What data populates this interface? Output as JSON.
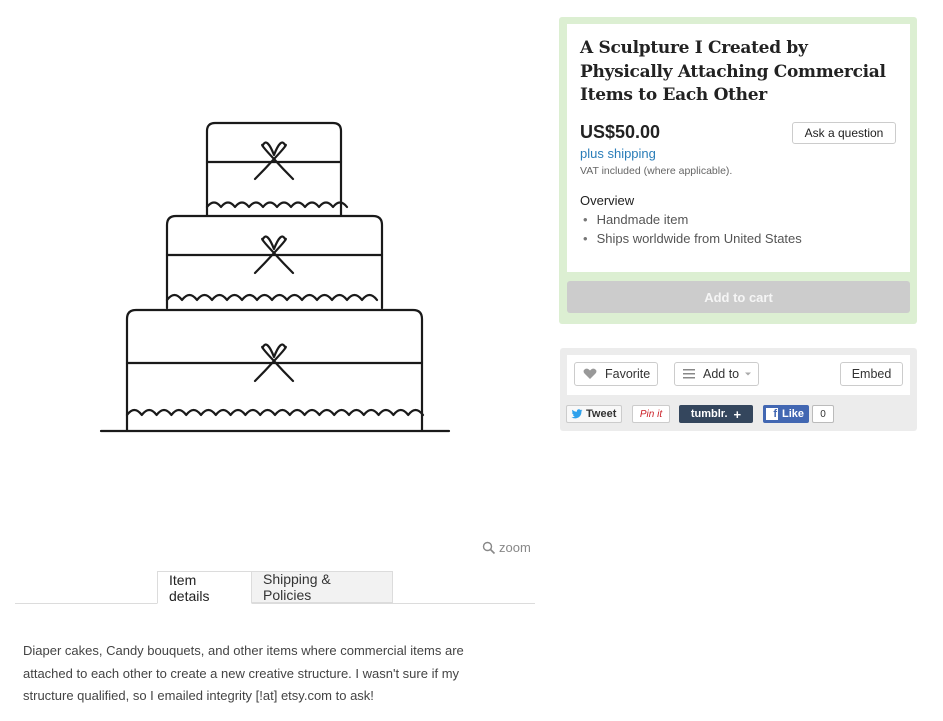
{
  "listing": {
    "title": "A Sculpture I Created by Physically Attaching Commercial Items to Each Other",
    "price": "US$50.00",
    "shipping_label": "plus shipping",
    "vat_note": "VAT included (where applicable).",
    "ask_button_label": "Ask a question",
    "overview_heading": "Overview",
    "overview_items": [
      "Handmade item",
      "Ships worldwide from United States"
    ],
    "add_to_cart_label": "Add to cart"
  },
  "actions": {
    "favorite_label": "Favorite",
    "add_to_label": "Add to",
    "embed_label": "Embed"
  },
  "share": {
    "tweet_label": "Tweet",
    "pinit_label": "Pin it",
    "tumblr_label": "tumblr.",
    "like_label": "Like",
    "like_count": "0"
  },
  "image": {
    "zoom_label": "zoom",
    "icon": "wedding-cake-line-drawing"
  },
  "tabs": [
    "Item details",
    "Shipping & Policies"
  ],
  "description": "Diaper cakes, Candy bouquets, and other items where commercial items are attached to each other to create a new creative structure. I wasn't sure if my structure qualified, so I emailed integrity [!at] etsy.com to ask!",
  "colors": {
    "buy_box_border": "#dcefd2",
    "link_blue": "#2a7db8",
    "add_to_cart_bg": "#cccccc",
    "tumblr": "#34465d",
    "facebook": "#4267b2"
  }
}
